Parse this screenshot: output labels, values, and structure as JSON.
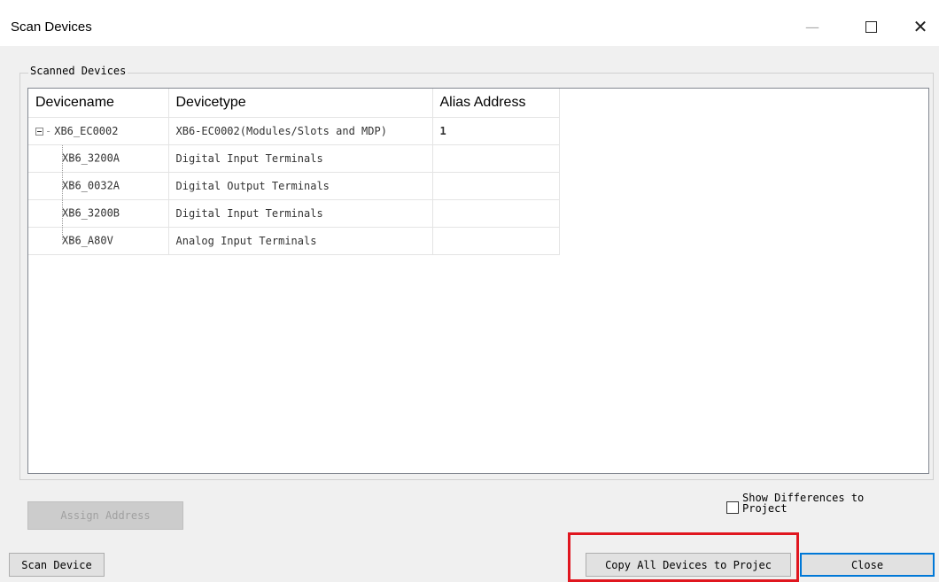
{
  "window": {
    "title": "Scan Devices",
    "minimize_icon": "—",
    "close_icon": "✕"
  },
  "group": {
    "label": "Scanned Devices"
  },
  "table": {
    "columns": [
      "Devicename",
      "Devicetype",
      "Alias Address"
    ],
    "rows": [
      {
        "name": "XB6_EC0002",
        "type": "XB6-EC0002(Modules/Slots and MDP)",
        "alias": "1",
        "level": 0
      },
      {
        "name": "XB6_3200A",
        "type": "Digital Input Terminals",
        "alias": "",
        "level": 1
      },
      {
        "name": "XB6_0032A",
        "type": "Digital Output Terminals",
        "alias": "",
        "level": 1
      },
      {
        "name": "XB6_3200B",
        "type": "Digital Input Terminals",
        "alias": "",
        "level": 1
      },
      {
        "name": "XB6_A80V",
        "type": "Analog Input Terminals",
        "alias": "",
        "level": 1
      }
    ]
  },
  "buttons": {
    "assign_address": "Assign Address",
    "scan_device": "Scan Device",
    "copy_all": "Copy All Devices to Projec",
    "close": "Close"
  },
  "checkbox": {
    "label": "Show Differences to Project",
    "checked": false
  },
  "colors": {
    "highlight": "#e0161f",
    "default_button_border": "#0078d7"
  }
}
